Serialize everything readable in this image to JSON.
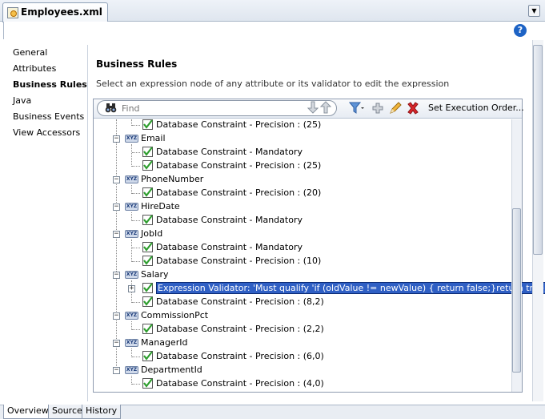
{
  "tab": {
    "title": "Employees.xml"
  },
  "header": {
    "help_label": "?"
  },
  "nav": {
    "items": [
      {
        "label": "General",
        "active": false
      },
      {
        "label": "Attributes",
        "active": false
      },
      {
        "label": "Business Rules",
        "active": true
      },
      {
        "label": "Java",
        "active": false
      },
      {
        "label": "Business Events",
        "active": false
      },
      {
        "label": "View Accessors",
        "active": false
      }
    ]
  },
  "main": {
    "title": "Business Rules",
    "subtitle": "Select an expression node of any attribute or its validator to edit the expression",
    "toolbar": {
      "find_placeholder": "Find",
      "set_execution_order": "Set Execution Order...",
      "icons": [
        "binoculars-icon",
        "arrow-down-icon",
        "arrow-up-icon",
        "filter-icon",
        "add-icon",
        "edit-icon",
        "delete-icon"
      ]
    },
    "badge_text": "XYZ",
    "tree": {
      "r0": "Database Constraint - Precision : (25)",
      "email": "Email",
      "r1": "Database Constraint - Mandatory",
      "r2": "Database Constraint - Precision : (25)",
      "phone": "PhoneNumber",
      "r3": "Database Constraint - Precision : (20)",
      "hire": "HireDate",
      "r4": "Database Constraint - Mandatory",
      "job": "JobId",
      "r5": "Database Constraint - Mandatory",
      "r6": "Database Constraint - Precision : (10)",
      "salary": "Salary",
      "r7": "Expression Validator: 'Must qualify 'if (oldValue != newValue) {  return false;}return true;'",
      "r8": "Database Constraint - Precision : (8,2)",
      "comm": "CommissionPct",
      "r9": "Database Constraint - Precision : (2,2)",
      "mgr": "ManagerId",
      "r10": "Database Constraint - Precision : (6,0)",
      "dept": "DepartmentId",
      "r11": "Database Constraint - Precision : (4,0)"
    }
  },
  "bottom_tabs": [
    {
      "label": "Overview",
      "active": true
    },
    {
      "label": "Source",
      "active": false
    },
    {
      "label": "History",
      "active": false
    }
  ],
  "colors": {
    "selection": "#2f5fc4",
    "check": "#2e9e2e"
  }
}
